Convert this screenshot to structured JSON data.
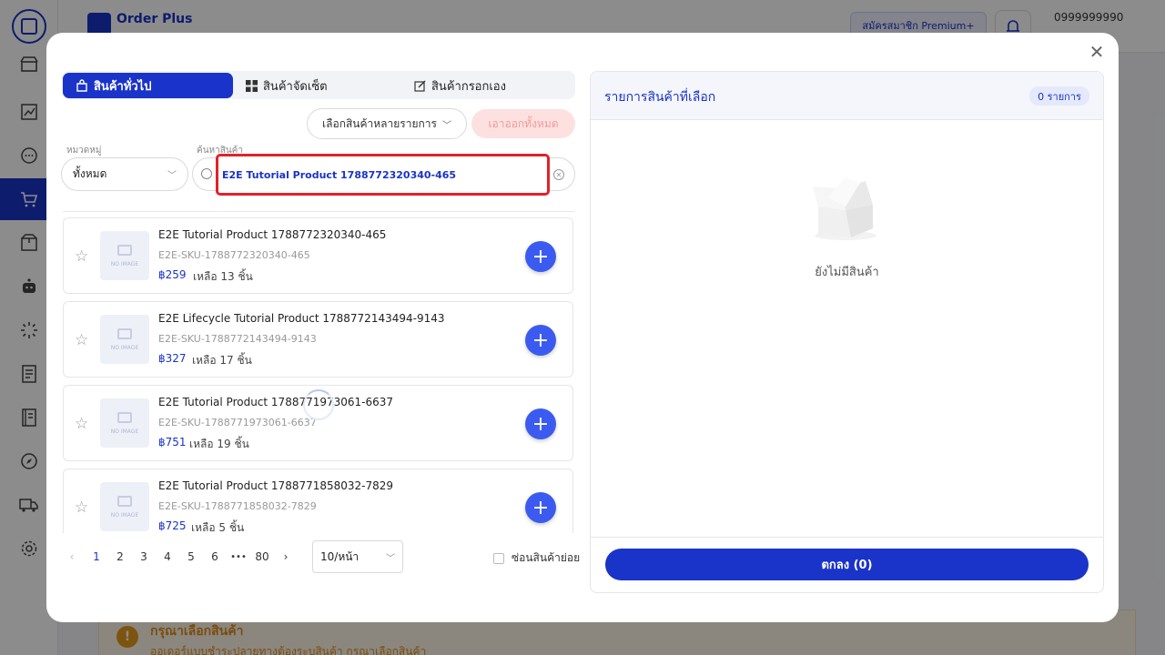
{
  "app": {
    "brand": "Order Plus",
    "premium": "สมัครสมาชิก Premium+",
    "phone": "0999999990",
    "warning_title": "กรุณาเลือกสินค้า",
    "warning_sub": "ออเดอร์แบบชำระปลายทางต้องระบุสินค้า กรุณาเลือกสินค้า"
  },
  "modal": {
    "tabs": [
      "สินค้าทั่วไป",
      "สินค้าจัดเซ็ต",
      "สินค้ากรอกเอง"
    ],
    "multi_select": "เลือกสินค้าหลายรายการ",
    "remove_all": "เอาออกทั้งหมด",
    "category_label": "หมวดหมู่",
    "category_value": "ทั้งหมด",
    "search_label": "ค้นหาสินค้า",
    "search_value": "E2E Tutorial Product 1788772320340-465"
  },
  "products": [
    {
      "name": "E2E Tutorial Product 1788772320340-465",
      "sku": "E2E-SKU-1788772320340-465",
      "price": "฿259",
      "stock": "เหลือ 13 ชิ้น"
    },
    {
      "name": "E2E Lifecycle Tutorial Product 1788772143494-9143",
      "sku": "E2E-SKU-1788772143494-9143",
      "price": "฿327",
      "stock": "เหลือ 17 ชิ้น"
    },
    {
      "name": "E2E Tutorial Product 1788771973061-6637",
      "sku": "E2E-SKU-1788771973061-6637",
      "price": "฿751",
      "stock": "เหลือ 19 ชิ้น"
    },
    {
      "name": "E2E Tutorial Product 1788771858032-7829",
      "sku": "E2E-SKU-1788771858032-7829",
      "price": "฿725",
      "stock": "เหลือ 5 ชิ้น"
    }
  ],
  "no_image": "NO IMAGE",
  "pagination": {
    "pages": [
      "1",
      "2",
      "3",
      "4",
      "5",
      "6",
      "•••",
      "80"
    ],
    "current": "1",
    "page_size": "10/หน้า",
    "hide_sub": "ซ่อนสินค้าย่อย"
  },
  "selected": {
    "title": "รายการสินค้าที่เลือก",
    "count": "0 รายการ",
    "empty": "ยังไม่มีสินค้า",
    "confirm": "ตกลง (0)"
  }
}
